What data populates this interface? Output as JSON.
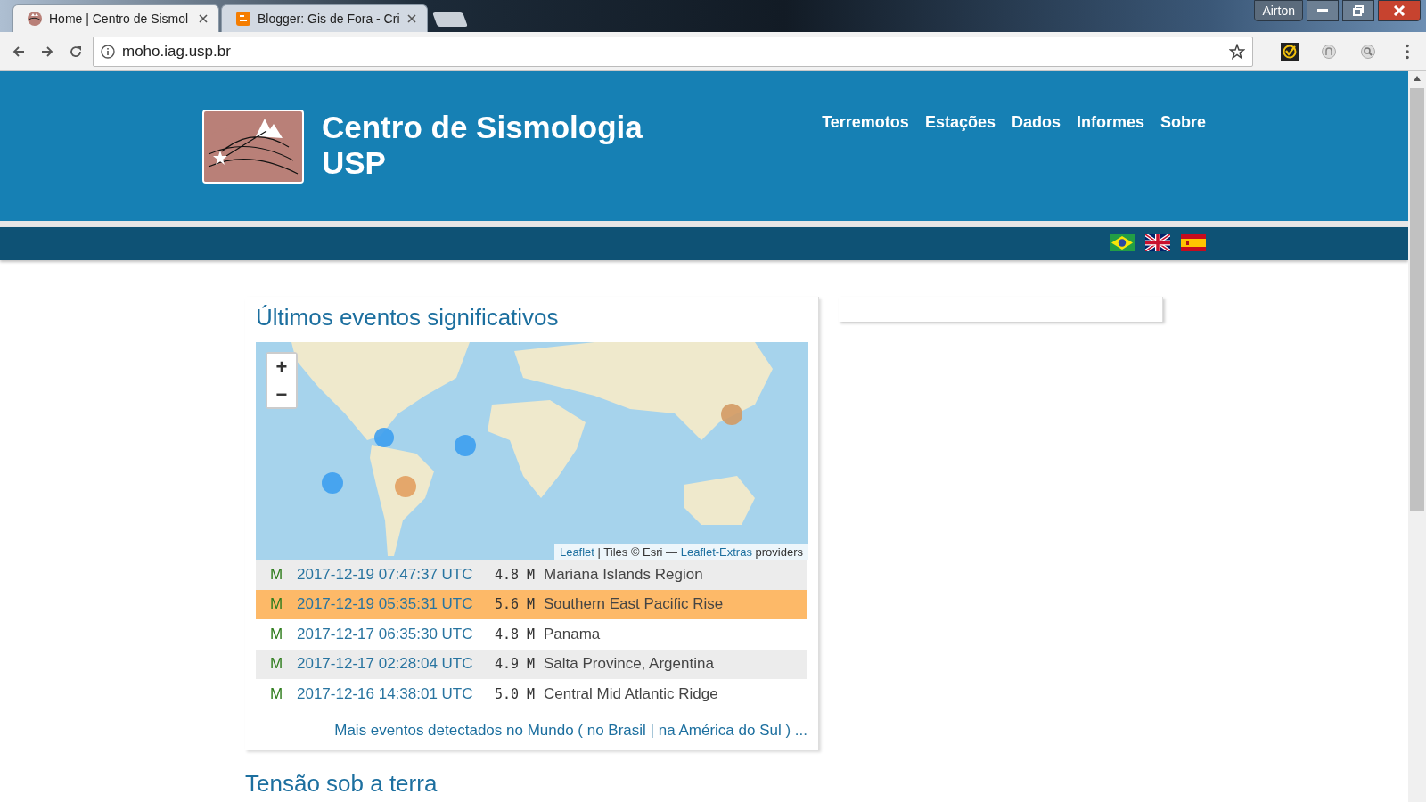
{
  "browser": {
    "tabs": [
      {
        "title": "Home | Centro de Sismol",
        "selected": true,
        "kind": "site"
      },
      {
        "title": "Blogger: Gis de Fora - Cri",
        "selected": false,
        "kind": "blogger"
      }
    ],
    "profile": "Airton",
    "address": "moho.iag.usp.br"
  },
  "site": {
    "title_lines": [
      "Centro de Sismologia",
      "USP"
    ],
    "nav": [
      "Terremotos",
      "Estações",
      "Dados",
      "Informes",
      "Sobre"
    ],
    "languages": [
      {
        "kind": "br"
      },
      {
        "kind": "uk"
      },
      {
        "kind": "es"
      }
    ]
  },
  "events_section": {
    "title": "Últimos eventos significativos",
    "map": {
      "zoom_in": "+",
      "zoom_out": "−",
      "attribution": [
        {
          "text": "Leaflet",
          "link": true
        },
        {
          "text": " | Tiles © Esri — ",
          "link": false
        },
        {
          "text": "Leaflet-Extras",
          "link": true
        },
        {
          "text": " providers",
          "link": false
        }
      ]
    },
    "events": [
      {
        "type": "M",
        "time": "2017-12-19 07:47:37 UTC",
        "magnitude": "4.8 M",
        "region": "Mariana Islands Region",
        "selected": false,
        "shaded": true
      },
      {
        "type": "M",
        "time": "2017-12-19 05:35:31 UTC",
        "magnitude": "5.6 M",
        "region": "Southern East Pacific Rise",
        "selected": true,
        "shaded": false
      },
      {
        "type": "M",
        "time": "2017-12-17 06:35:30 UTC",
        "magnitude": "4.8 M",
        "region": "Panama",
        "selected": false,
        "shaded": false
      },
      {
        "type": "M",
        "time": "2017-12-17 02:28:04 UTC",
        "magnitude": "4.9 M",
        "region": "Salta Province, Argentina",
        "selected": false,
        "shaded": true
      },
      {
        "type": "M",
        "time": "2017-12-16 14:38:01 UTC",
        "magnitude": "5.0 M",
        "region": "Central Mid Atlantic Ridge",
        "selected": false,
        "shaded": false
      }
    ],
    "more": [
      {
        "text": "Mais eventos detectados no Mundo",
        "link": true
      },
      {
        "text": " ( ",
        "link": false
      },
      {
        "text": "no Brasil",
        "link": true
      },
      {
        "text": " | ",
        "link": false
      },
      {
        "text": "na América do Sul",
        "link": true
      },
      {
        "text": " ) ...",
        "link": false
      }
    ]
  },
  "next_section_title": "Tensão sob a terra"
}
